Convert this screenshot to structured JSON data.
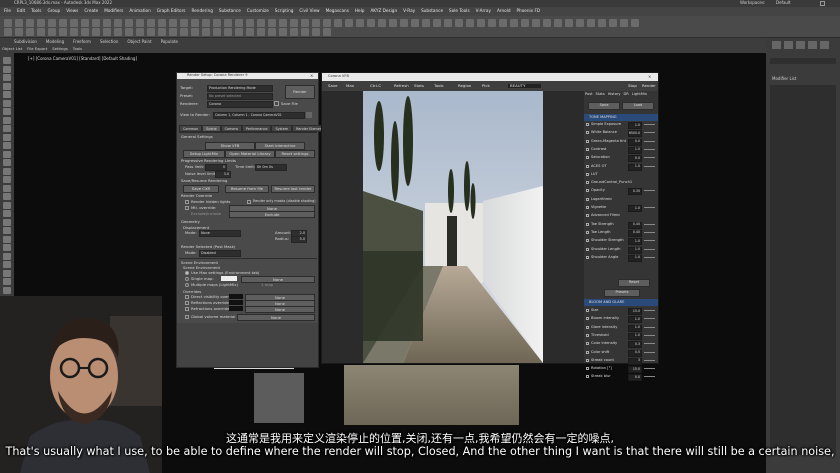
{
  "window": {
    "title": "CRPL3_10686.3ds.max - Autodesk 3ds Max 2022",
    "workspace_label": "Workspaces:",
    "workspace_value": "Default"
  },
  "menu": [
    "File",
    "Edit",
    "Tools",
    "Group",
    "Views",
    "Create",
    "Modifiers",
    "Animation",
    "Graph Editors",
    "Rendering",
    "Substance",
    "Customize",
    "Scripting",
    "Civil View",
    "Megascans",
    "Help",
    "AKYZ Design",
    "V-Ray",
    "Substance",
    "Sole Tools",
    "V-Array",
    "Arnold",
    "Phoenix FD"
  ],
  "ribbon": [
    "Subdivision",
    "Modeling",
    "Freeform",
    "Selection",
    "Object Paint",
    "Populate"
  ],
  "ribbon2": [
    "Object List",
    "File Export",
    "Settings",
    "Tools"
  ],
  "viewport_label": "[+] [Corona CameraV01] [Standard] [Default Shading]",
  "right_panel": {
    "title": "Modifier List"
  },
  "render_setup": {
    "title": "Render Setup: Corona Renderer 9",
    "target_label": "Target:",
    "target_value": "Production Rendering Mode",
    "preset_label": "Preset:",
    "preset_value": "No preset selected",
    "renderer_label": "Renderer:",
    "renderer_value": "Corona",
    "save_file": "Save File",
    "render_btn": "Render",
    "view_label": "View to Render:",
    "view_value": "Column 1, Column 1 - Corona CameraV01",
    "tabs": [
      "Common",
      "Scene",
      "Camera",
      "Performance",
      "System",
      "Render Elements"
    ],
    "general_settings": "General Settings",
    "show_vfb": "Show VFB",
    "start_interactive": "Start interactive",
    "setup_lightmix": "Setup LightMix",
    "open_material_library": "Open Material Library",
    "reset_settings": "Reset settings",
    "progressive_limits": "Progressive Rendering Limits",
    "pass_limit": "Pass limit:",
    "pass_limit_value": "0",
    "time_limit": "Time limit:",
    "time_limit_value": "0h 0m 0s",
    "noise_level": "Noise level limit:",
    "noise_level_value": "3.0",
    "save_resume": "Save/Resume Rendering",
    "save_cxr": "Save CXR",
    "resume_from_file": "Resume from file",
    "resume_last_render": "Resume last render",
    "render_override": "Render Override",
    "render_hidden_lights": "Render hidden lights",
    "render_only_masks": "Render only masks (disable shading)",
    "mtl_override": "Mtl. override:",
    "mtl_override_value": "None",
    "exclude": "Exclude/include",
    "exclude2": "Exclude",
    "geometry": "Geometry",
    "displacement": "Displacement",
    "mode_label": "Mode:",
    "mode_value": "None",
    "amount_label": "Amount:",
    "amount_value": "2.0",
    "radius_label": "Radius:",
    "radius_value": "5.0",
    "render_selected": "Render Selected (Post Mask)",
    "render_selected_mode": "Mode:",
    "render_selected_value": "Disabled",
    "scene_environment": "Scene Environment",
    "scene_env": "Scene Environment",
    "use_max_settings": "Use Max settings (Environment tab)",
    "single_map": "Single map:",
    "none1": "None",
    "multiple_maps": "Multiple maps (LightMix)",
    "one_map": "1 map",
    "overrides": "Overrides",
    "direct_visibility": "Direct visibility override",
    "reflections_override": "Reflections override",
    "refractions_override": "Refractions override",
    "none2": "None",
    "none3": "None",
    "none4": "None",
    "global_volume": "Global volume material",
    "none5": "None"
  },
  "vfb": {
    "title": "Corona VFB",
    "toolbar": [
      "Save",
      "Max",
      "Ctrl-C",
      "Refresh",
      "Stats",
      "Tools",
      "Region",
      "Pick",
      "BEAUTY",
      "Stop",
      "Render"
    ],
    "tabs": [
      "Post",
      "Stats",
      "History",
      "DR",
      "LightMix"
    ],
    "save_btn": "Save",
    "load_btn": "Load",
    "tone_mapping": "TONE MAPPING",
    "tone_rows": [
      {
        "label": "Simple Exposure",
        "value": "1.0"
      },
      {
        "label": "White Balance",
        "value": "6500.0"
      },
      {
        "label": "Green-Magenta tint",
        "value": "0.0"
      },
      {
        "label": "Contrast",
        "value": "1.0"
      },
      {
        "label": "Saturation",
        "value": "0.0"
      },
      {
        "label": "ACES OT",
        "value": "1.0"
      },
      {
        "label": "LUT",
        "value": ""
      },
      {
        "label": "GroundControl_Punch1",
        "value": ""
      },
      {
        "label": "Opacity",
        "value": "0.30"
      },
      {
        "label": "Logarithmic",
        "value": ""
      },
      {
        "label": "Vignette",
        "value": "1.0"
      },
      {
        "label": "Advanced Filmic",
        "value": ""
      },
      {
        "label": "Toe Strength",
        "value": "0.40"
      },
      {
        "label": "Toe Length",
        "value": "0.40"
      },
      {
        "label": "Shoulder Strength",
        "value": "1.0"
      },
      {
        "label": "Shoulder Length",
        "value": "1.0"
      },
      {
        "label": "Shoulder Angle",
        "value": "1.0"
      }
    ],
    "reset": "Reset",
    "presets": "Presets",
    "bloom_glare": "BLOOM AND GLARE",
    "bloom_rows": [
      {
        "label": "Size",
        "value": "15.0"
      },
      {
        "label": "Bloom intensity",
        "value": "1.0"
      },
      {
        "label": "Glare intensity",
        "value": "1.0"
      },
      {
        "label": "Threshold",
        "value": "1.0"
      },
      {
        "label": "Color intensity",
        "value": "0.3"
      },
      {
        "label": "Color shift",
        "value": "0.5"
      },
      {
        "label": "Streak count",
        "value": "3"
      },
      {
        "label": "Rotation [°]",
        "value": "15.0"
      },
      {
        "label": "Streak blur",
        "value": "0.0"
      }
    ]
  },
  "subtitles": {
    "cn": "这通常是我用来定义渲染停止的位置,关闭,还有一点,我希望仍然会有一定的噪点,",
    "en": "That's usually what I use, to be able to define where the render will stop, Closed, And the other thing I want is that there will still be a certain noise,"
  }
}
